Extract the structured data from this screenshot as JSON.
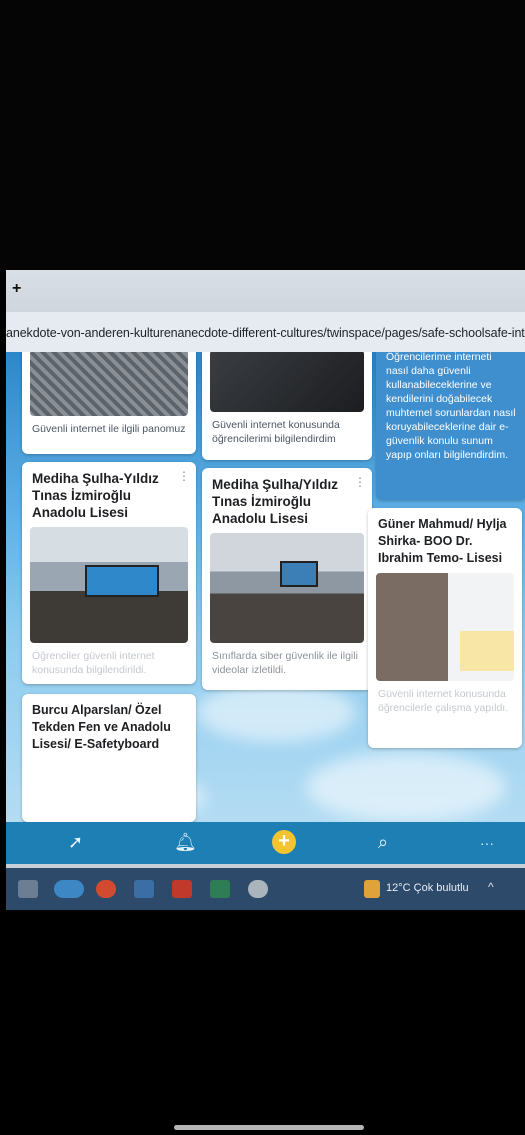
{
  "browser": {
    "new_tab_label": "+",
    "url": "anekdote-von-anderen-kulturenanecdote-different-cultures/twinspace/pages/safe-schoolsafe-int"
  },
  "board": {
    "cards": [
      {
        "caption": "Güvenli internet ile ilgili panomuz"
      },
      {
        "caption": "Güvenli internet konusunda öğrencilerimi bilgilendirdim"
      },
      {
        "text": "Öğrencilerime interneti nasıl daha güvenli kullanabileceklerine ve kendilerini doğabilecek muhtemel sorunlardan nasıl koruyabileceklerine dair e-güvenlik konulu  sunum yapıp onları bilgilendirdim."
      },
      {
        "title": "Mediha Şulha-Yıldız Tınas İzmiroğlu Anadolu Lisesi",
        "caption": "Öğrenciler güvenli internet konusunda bilgilendirildi."
      },
      {
        "title": "Mediha Şulha/Yıldız Tınas İzmiroğlu Anadolu Lisesi",
        "caption": "Sınıflarda siber güvenlik ile ilgili videolar izletildi."
      },
      {
        "title": "Güner Mahmud/ Hylja Shirka- BOO Dr. Ibrahim Temo- Lisesi",
        "caption": "Güvenli internet konusunda öğrencilerle çalışma yapıldı."
      },
      {
        "title": "Burcu Alparslan/ Özel Tekden Fen ve Anadolu Lisesi/ E-Safetyboard"
      }
    ]
  },
  "toolbar": {
    "add_label": "+",
    "more_label": "···"
  },
  "taskbar": {
    "weather": "12°C  Çok bulutlu"
  }
}
